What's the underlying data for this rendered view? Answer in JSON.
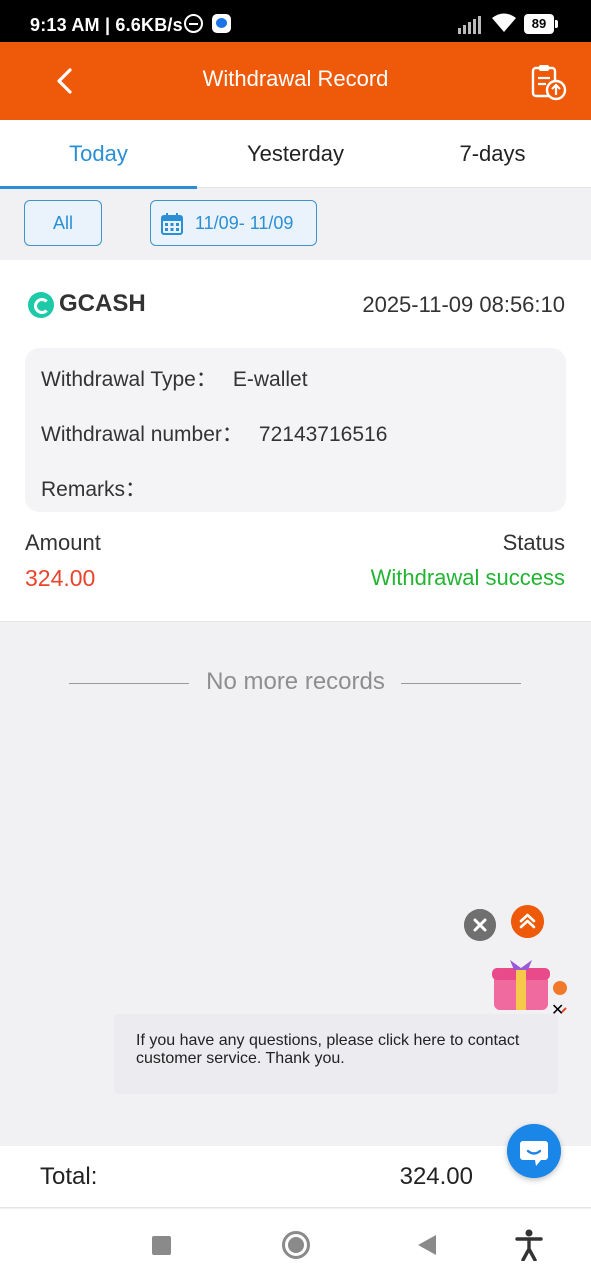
{
  "status_bar": {
    "time": "9:13 AM | 6.6KB/s",
    "battery": "89",
    "icons": [
      "do-not-disturb-icon",
      "messenger-icon",
      "signal-icon",
      "wifi-icon",
      "battery-icon"
    ]
  },
  "header": {
    "title": "Withdrawal Record",
    "back_icon": "back-chevron-icon",
    "right_icon": "clipboard-upload-icon"
  },
  "tabs": [
    {
      "label": "Today",
      "active": true
    },
    {
      "label": "Yesterday",
      "active": false
    },
    {
      "label": "7-days",
      "active": false
    }
  ],
  "filters": {
    "all_label": "All",
    "date_range": "11/09- 11/09"
  },
  "record": {
    "provider": "GCASH",
    "datetime": "2025-11-09 08:56:10",
    "type_label": "Withdrawal Type：",
    "type_value": "E-wallet",
    "number_label": "Withdrawal number：",
    "number_value": "72143716516",
    "remarks_label": "Remarks：",
    "remarks_value": "",
    "amount_label": "Amount",
    "amount_value": "324.00",
    "status_label": "Status",
    "status_value": "Withdrawal success"
  },
  "list_end_text": "No more records",
  "support_tooltip": "If you have any questions, please click here to contact customer service. Thank you.",
  "footer": {
    "total_label": "Total:",
    "total_value": "324.00"
  },
  "colors": {
    "accent": "#ef5a0a",
    "tab_active": "#2b8fd6",
    "amount": "#e8452c",
    "success": "#22b531"
  }
}
